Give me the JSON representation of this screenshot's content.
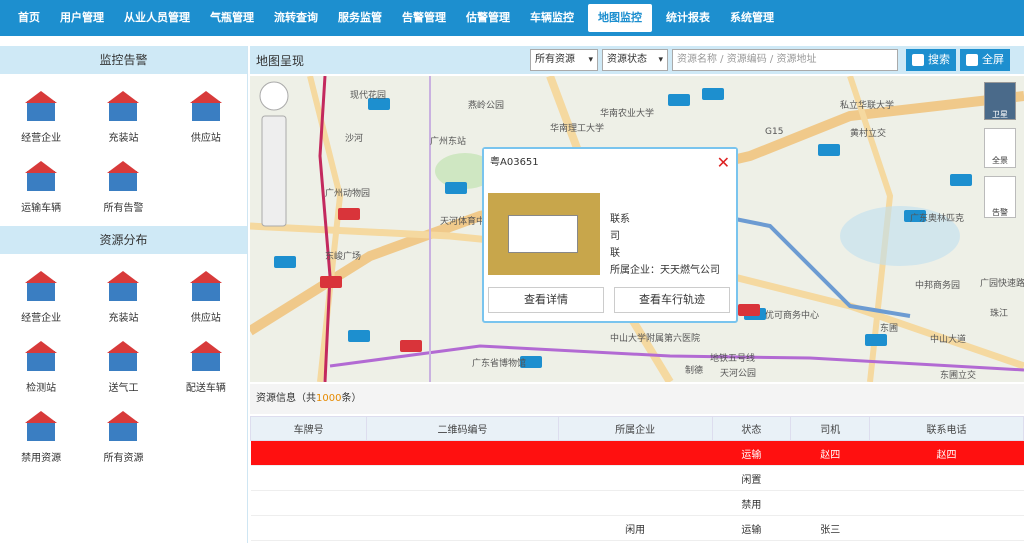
{
  "nav": [
    "首页",
    "用户管理",
    "从业人员管理",
    "气瓶管理",
    "流转查询",
    "服务监管",
    "告警管理",
    "估警管理",
    "车辆监控",
    "地图监控",
    "统计报表",
    "系统管理"
  ],
  "nav_active": 9,
  "left": {
    "monitor_title": "监控告警",
    "monitor_items": [
      {
        "label": "经营企业",
        "icon": "house-red-icon"
      },
      {
        "label": "充装站",
        "icon": "factory-icon"
      },
      {
        "label": "供应站",
        "icon": "house-icon"
      },
      {
        "label": "运输车辆",
        "icon": "truck-icon"
      },
      {
        "label": "所有告警",
        "icon": "alarm-icon"
      }
    ],
    "resource_title": "资源分布",
    "resource_items": [
      {
        "label": "经营企业",
        "icon": "house-blue-icon"
      },
      {
        "label": "充装站",
        "icon": "factory-icon"
      },
      {
        "label": "供应站",
        "icon": "house-icon"
      },
      {
        "label": "检测站",
        "icon": "house-check-icon"
      },
      {
        "label": "送气工",
        "icon": "worker-icon"
      },
      {
        "label": "配送车辆",
        "icon": "truck-icon"
      },
      {
        "label": "禁用资源",
        "icon": "forbidden-icon"
      },
      {
        "label": "所有资源",
        "icon": "building-icon"
      }
    ]
  },
  "mapbar": {
    "title": "地图呈现",
    "resource_select": "所有资源",
    "status_select": "资源状态",
    "search_placeholder": "资源名称 / 资源编码 / 资源地址",
    "search_btn": "搜索",
    "fullscreen_btn": "全屏"
  },
  "map": {
    "labels": [
      "现代花园",
      "燕岭公园",
      "华南农业大学",
      "华南理工大学",
      "广州东站",
      "沙河",
      "广州动物园",
      "天河体育中心",
      "东峻广场",
      "广东省博物馆",
      "中山大学附属第六医院",
      "制德",
      "优可商务中心",
      "东圃",
      "中邦商务园",
      "黄村立交",
      "私立华联大学",
      "广东奥林匹克",
      "珠江",
      "东圃立交",
      "中山大道",
      "天河公园",
      "G15",
      "地铁五号线",
      "广园快速路"
    ],
    "controls": {
      "satellite": "卫星",
      "panorama": "全景",
      "alarm": "告警"
    }
  },
  "popup": {
    "title": "粤A03651",
    "contact_label": "联系",
    "driver_label": "司",
    "phone_label": "联",
    "company": "所属企业：天天燃气公司",
    "detail_btn": "查看详情",
    "track_btn": "查看车行轨迹"
  },
  "result": {
    "text_prefix": "资源信息（共",
    "count": "1000",
    "text_suffix": "条）"
  },
  "table": {
    "headers": [
      "车牌号",
      "二维码编号",
      "所属企业",
      "状态",
      "司机",
      "联系电话"
    ],
    "rows": [
      [
        "",
        "",
        "",
        "运输",
        "赵四",
        "赵四"
      ],
      [
        "",
        "",
        "",
        "闲置",
        "",
        ""
      ],
      [
        "",
        "",
        "",
        "禁用",
        "",
        ""
      ],
      [
        "",
        "",
        "闲用",
        "运输",
        "张三",
        ""
      ]
    ]
  }
}
